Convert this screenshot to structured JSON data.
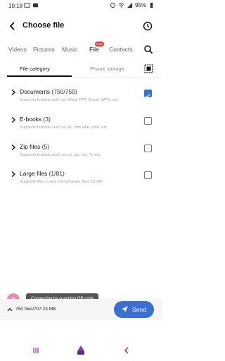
{
  "status_bar": {
    "time": "10:18",
    "battery": "95%"
  },
  "header": {
    "title": "Choose file"
  },
  "tabs": [
    {
      "label": "Videos",
      "active": false
    },
    {
      "label": "Pictures",
      "active": false
    },
    {
      "label": "Music",
      "active": false
    },
    {
      "label": "File",
      "active": true,
      "badge": "New"
    },
    {
      "label": "Contacts",
      "active": false
    }
  ],
  "subtabs": [
    {
      "label": "File category",
      "active": true
    },
    {
      "label": "Phone storage",
      "active": false
    }
  ],
  "categories": [
    {
      "title": "Documents",
      "count": "(750/750)",
      "desc": "Supports formats such as Word, PPT, Excel, WPS, etc.",
      "checked": true
    },
    {
      "title": "E-books",
      "count": "(3)",
      "desc": "Supports formats such as txt, chm ebk, umd, etc.",
      "checked": false
    },
    {
      "title": "Zip files",
      "count": "(5)",
      "desc": "Supports formats such as rar, zip, iso, 7z etc.",
      "checked": false
    },
    {
      "title": "Large files",
      "count": "(1/81)",
      "desc": "Supports files in any format larger than 50 MB",
      "checked": false
    }
  ],
  "connection": {
    "avatar_letter": "S",
    "device_name": "SM-A325F",
    "tooltip": "Connecting by scanning QR code"
  },
  "footer": {
    "summary": "750 files/707.23 MB",
    "send_label": "Send"
  },
  "colors": {
    "accent": "#3b6fd1",
    "badge": "#e53935"
  }
}
